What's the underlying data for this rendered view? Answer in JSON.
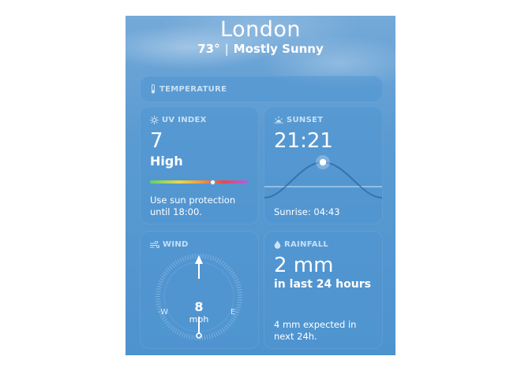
{
  "header": {
    "city": "London",
    "temperature": "73°",
    "separator": "|",
    "condition": "Mostly Sunny"
  },
  "temperature_card": {
    "label": "TEMPERATURE",
    "icon": "thermometer-icon"
  },
  "uv_card": {
    "label": "UV INDEX",
    "icon": "sun-icon",
    "value": "7",
    "level": "High",
    "level_fraction": 0.64,
    "advice_line1": "Use sun protection",
    "advice_line2": "until 18:00."
  },
  "sunset_card": {
    "label": "SUNSET",
    "icon": "sunset-icon",
    "time": "21:21",
    "sunrise": "Sunrise: 04:43"
  },
  "wind_card": {
    "label": "WIND",
    "icon": "wind-icon",
    "speed": "8",
    "unit": "mph",
    "compass": {
      "west": "W",
      "east": "E"
    }
  },
  "rain_card": {
    "label": "RAINFALL",
    "icon": "raindrop-icon",
    "amount": "2 mm",
    "period": "in last 24 hours",
    "forecast_line1": "4 mm expected in",
    "forecast_line2": "next 24h."
  },
  "colors": {
    "uv_gradient": [
      "#5fd16a",
      "#e8d84a",
      "#f0a040",
      "#e5484f",
      "#b45ce0"
    ]
  }
}
